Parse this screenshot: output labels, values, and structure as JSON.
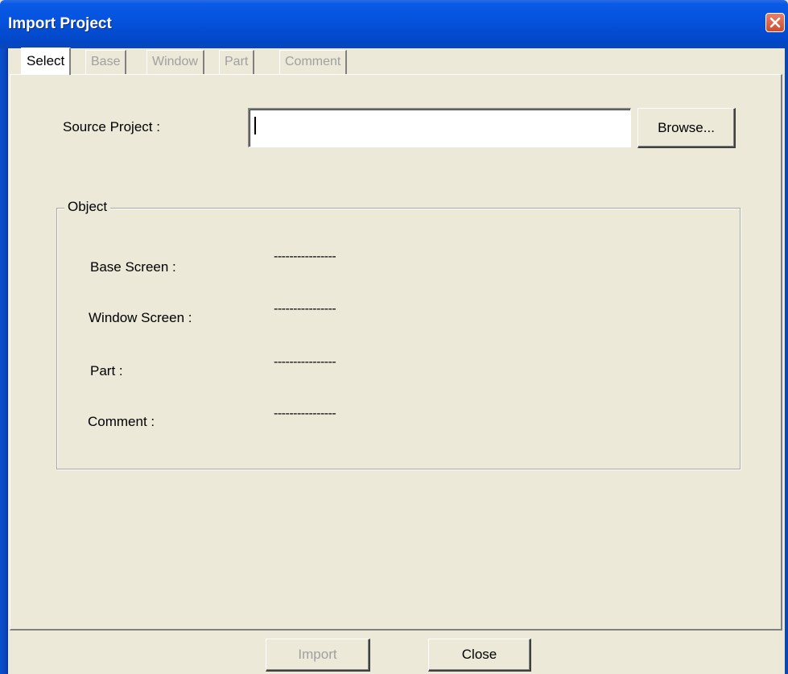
{
  "window": {
    "title": "Import Project"
  },
  "tabs": [
    {
      "label": "Select",
      "active": true,
      "enabled": true
    },
    {
      "label": "Base",
      "active": false,
      "enabled": false
    },
    {
      "label": "Window",
      "active": false,
      "enabled": false
    },
    {
      "label": "Part",
      "active": false,
      "enabled": false
    },
    {
      "label": "Comment",
      "active": false,
      "enabled": false
    }
  ],
  "source": {
    "label": "Source Project :",
    "value": "",
    "browse_label": "Browse..."
  },
  "object_group": {
    "legend": "Object",
    "rows": [
      {
        "label": "Base Screen :",
        "value": "----------------"
      },
      {
        "label": "Window Screen :",
        "value": "----------------"
      },
      {
        "label": "Part :",
        "value": "----------------"
      },
      {
        "label": "Comment :",
        "value": "----------------"
      }
    ]
  },
  "buttons": {
    "import_label": "Import",
    "import_enabled": false,
    "close_label": "Close"
  },
  "icons": {
    "close": "close-icon"
  },
  "colors": {
    "titlebar": "#0553DE",
    "dialog_bg": "#ECE9D8",
    "close_button": "#CE4D2E",
    "disabled_text": "#A0A0A0"
  }
}
